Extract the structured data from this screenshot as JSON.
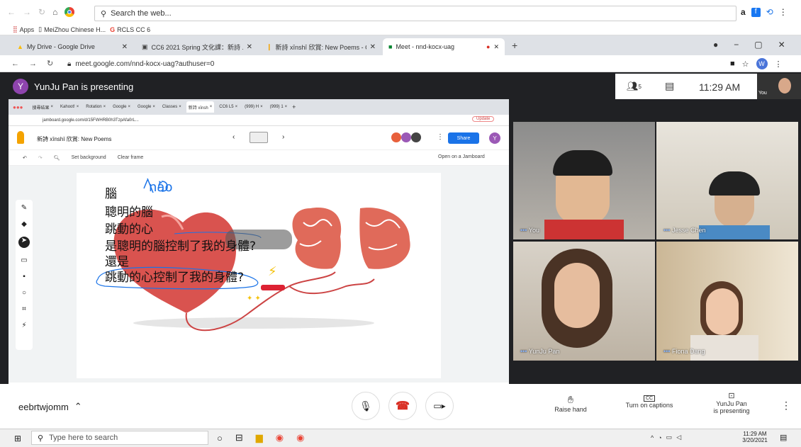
{
  "outer_browser": {
    "search_placeholder": "Search the web...",
    "bookmarks": [
      {
        "label": "Apps"
      },
      {
        "label": "MeiZhou Chinese H..."
      },
      {
        "label": "RCLS CC 6"
      }
    ],
    "tabs": [
      {
        "label": "My Drive - Google Drive"
      },
      {
        "label": "CC6 2021 Spring 文化課：新詩 ..."
      },
      {
        "label": "新詩 xīnshī 欣賞: New Poems - C"
      },
      {
        "label": "Meet - nnd-kocx-uag"
      }
    ],
    "url": "meet.google.com/nnd-kocx-uag?authuser=0",
    "profile_initial": "W"
  },
  "meet": {
    "presenter_initial": "Y",
    "presenting_banner": "YunJu Pan is presenting",
    "participant_count": "5",
    "time": "11:29 AM",
    "self_label": "You",
    "meeting_code": "eebrtwjomm",
    "controls": {
      "raise_hand": "Raise hand",
      "captions": "Turn on captions",
      "presenting_line1": "YunJu Pan",
      "presenting_line2": "is presenting",
      "captions_icon_text": "CC"
    },
    "participants": [
      {
        "name": "You"
      },
      {
        "name": "Jesse Chen"
      },
      {
        "name": "YunJu Pan"
      },
      {
        "name": "Fiona Dang"
      }
    ]
  },
  "jamboard": {
    "inner_tabs": [
      "搜尋結果",
      "Kahoot!",
      "Rotation",
      "Google",
      "Google",
      "Classes",
      "新詩 xīnsh",
      "CC6 L5",
      "(999) H",
      "(999) 1"
    ],
    "inner_url": "jamboard.google.com/d/15FWHRB0h3TzpAfa0rL...",
    "update_label": "Update",
    "title": "新詩 xīnshī 欣賞: New Poems",
    "share_label": "Share",
    "open_label": "Open on a Jamboard",
    "set_background": "Set background",
    "clear_frame": "Clear frame",
    "annotation": "nǎo",
    "poem_lines": [
      "腦",
      "聰明的腦",
      "跳動的心",
      "是聰明的腦控制了我的身體?",
      "還是",
      "跳動的心控制了我的身體?"
    ]
  },
  "taskbar": {
    "search_placeholder": "Type here to search",
    "time": "11:29 AM",
    "date": "3/20/2021"
  },
  "colors": {
    "meet_bg": "#202124",
    "presenter_avatar": "#8e44ad",
    "hangup": "#d93025",
    "share_button": "#1a73e8",
    "heart": "#d9534f",
    "brain": "#e06a5a"
  }
}
